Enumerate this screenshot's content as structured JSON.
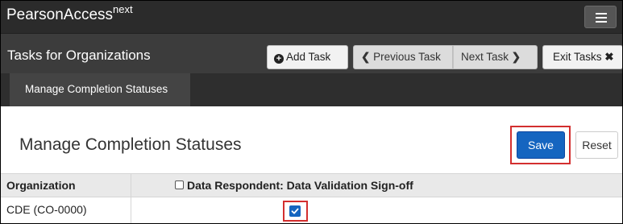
{
  "app": {
    "brand": "PearsonAccess",
    "brand_superscript": "next",
    "menu_icon": "hamburger-menu-icon"
  },
  "taskbar": {
    "title": "Tasks for Organizations",
    "add_task_label": "Add Task",
    "previous_task_label": "Previous Task",
    "next_task_label": "Next Task",
    "exit_tasks_label": "Exit Tasks"
  },
  "subnav": {
    "active_tab": "Manage Completion Statuses"
  },
  "content": {
    "title": "Manage Completion Statuses",
    "save_label": "Save",
    "reset_label": "Reset"
  },
  "table": {
    "columns": [
      "Organization",
      "Data Respondent: Data Validation Sign-off"
    ],
    "header_checkbox_checked": false,
    "rows": [
      {
        "organization": "CDE (CO-0000)",
        "signoff_checked": true
      }
    ]
  },
  "colors": {
    "accent": "#1565c0",
    "highlight": "#d32f2f",
    "topbar": "#2b2b2b"
  }
}
